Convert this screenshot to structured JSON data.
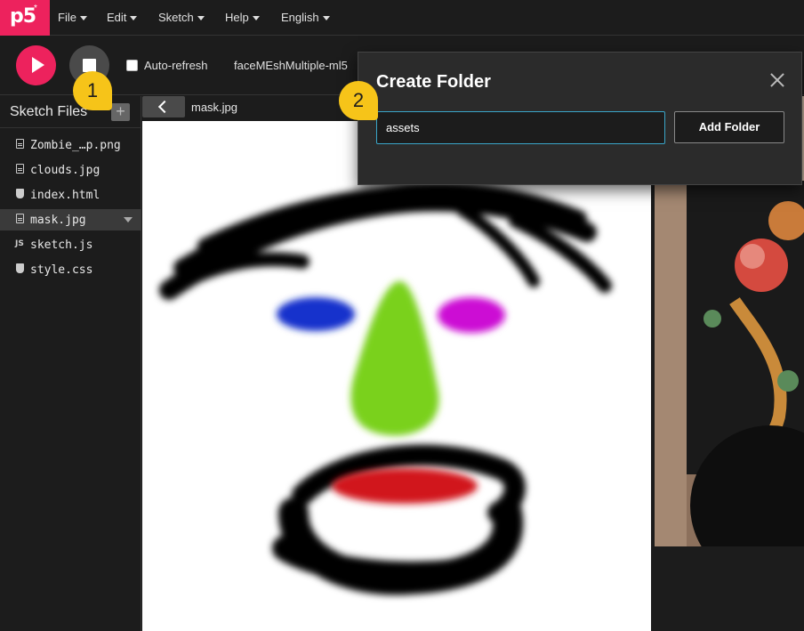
{
  "app": {
    "logo_text": "p5",
    "logo_star": "*",
    "accent_color": "#ed225d"
  },
  "menu": {
    "items": [
      {
        "label": "File"
      },
      {
        "label": "Edit"
      },
      {
        "label": "Sketch"
      },
      {
        "label": "Help"
      },
      {
        "label": "English"
      }
    ]
  },
  "toolbar": {
    "play_icon": "play-icon",
    "stop_icon": "stop-icon",
    "autorefresh_label": "Auto-refresh",
    "autorefresh_checked": false,
    "sketch_name": "faceMEshMultiple-ml5"
  },
  "sidebar": {
    "title": "Sketch Files",
    "add_button_symbol": "+",
    "files": [
      {
        "name": "Zombie_…p.png",
        "icon": "file-icon"
      },
      {
        "name": "clouds.jpg",
        "icon": "file-icon"
      },
      {
        "name": "index.html",
        "icon": "html-icon"
      },
      {
        "name": "mask.jpg",
        "icon": "file-icon",
        "selected": true
      },
      {
        "name": "sketch.js",
        "icon": "js-icon"
      },
      {
        "name": "style.css",
        "icon": "css-icon"
      }
    ]
  },
  "editor": {
    "filename": "mask.jpg"
  },
  "dialog": {
    "title": "Create Folder",
    "input_value": "assets",
    "add_button": "Add Folder"
  },
  "callouts": {
    "step1": "1",
    "step2": "2",
    "color": "#f6c419"
  }
}
